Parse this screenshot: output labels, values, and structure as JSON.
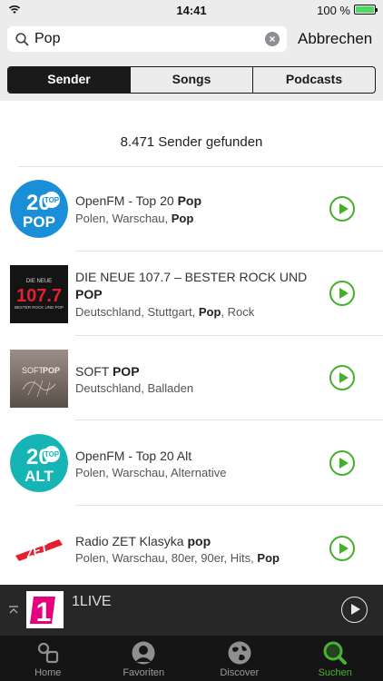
{
  "status": {
    "time": "14:41",
    "battery": "100 %"
  },
  "search": {
    "query": "Pop",
    "cancel_label": "Abbrechen"
  },
  "segments": [
    {
      "label": "Sender",
      "active": true
    },
    {
      "label": "Songs",
      "active": false
    },
    {
      "label": "Podcasts",
      "active": false
    }
  ],
  "results": {
    "count_text": "8.471 Sender gefunden",
    "items": [
      {
        "title_pre": "OpenFM - Top 20 ",
        "title_bold": "Pop",
        "sub_pre": "Polen, Warschau, ",
        "sub_bold": "Pop",
        "sub_post": "",
        "logo_text_top": "20",
        "logo_badge": "TOP",
        "logo_text_bottom": "POP",
        "logo_color": "#1a8fd8"
      },
      {
        "title_pre": "DIE NEUE 107.7 – BESTER ROCK UND ",
        "title_bold": "POP",
        "sub_pre": "Deutschland, Stuttgart, ",
        "sub_bold": "Pop",
        "sub_post": ", Rock",
        "logo_text_top": "DIE NEUE",
        "logo_text_main": "107.7",
        "logo_text_bottom": "BESTER ROCK UND POP"
      },
      {
        "title_pre": "SOFT ",
        "title_bold": "POP",
        "sub_pre": "Deutschland, Balladen",
        "sub_bold": "",
        "sub_post": "",
        "logo_text_soft": "SOFT",
        "logo_text_pop": "POP"
      },
      {
        "title_pre": "OpenFM - Top 20 Alt",
        "title_bold": "",
        "sub_pre": "Polen, Warschau, Alternative",
        "sub_bold": "",
        "sub_post": "",
        "logo_text_top": "20",
        "logo_badge": "TOP",
        "logo_text_bottom": "ALT",
        "logo_color": "#16b5b5"
      },
      {
        "title_pre": "Radio ZET Klasyka ",
        "title_bold": "pop",
        "sub_pre": "Polen, Warschau, 80er, 90er, Hits, ",
        "sub_bold": "Pop",
        "sub_post": "",
        "logo_text": "ZET"
      }
    ]
  },
  "player": {
    "station": "1LIVE",
    "art_text": "1"
  },
  "tabs": [
    {
      "label": "Home",
      "icon": "home-icon",
      "active": false
    },
    {
      "label": "Favoriten",
      "icon": "favorites-icon",
      "active": false
    },
    {
      "label": "Discover",
      "icon": "globe-icon",
      "active": false
    },
    {
      "label": "Suchen",
      "icon": "search-icon",
      "active": true
    }
  ],
  "colors": {
    "accent": "#43b02a",
    "tab_active": "#4bb035",
    "segment_active": "#1a1a1a"
  }
}
